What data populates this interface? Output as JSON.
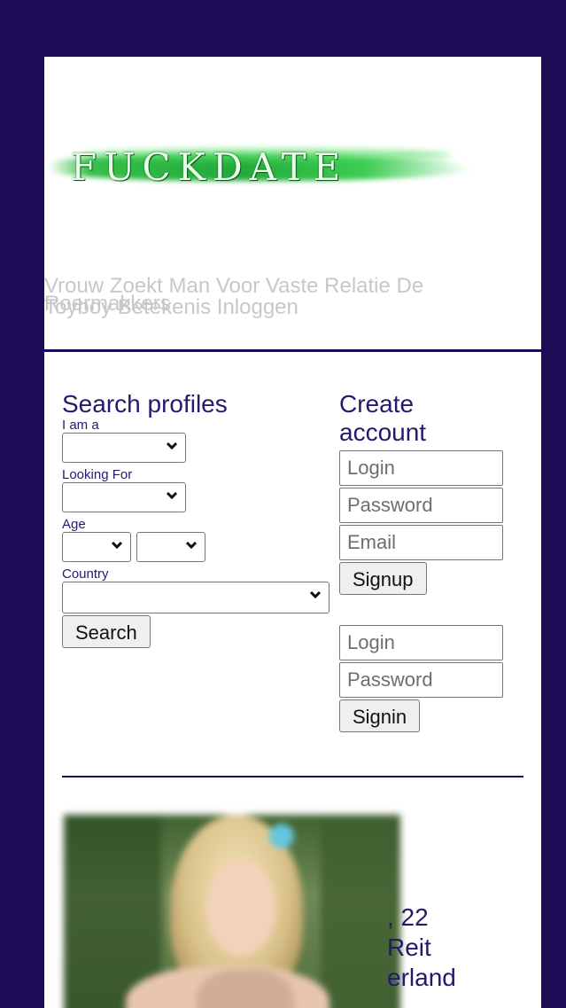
{
  "header": {
    "logo_text": "FUCKDATE",
    "tagline_line1": "Vrouw Zoekt Man Voor Vaste Relatie De",
    "tagline_line2": "Toyboy Betekenis Inloggen",
    "tagline_overlap": "Roermakkers"
  },
  "search": {
    "title": "Search profiles",
    "i_am_label": "I am a",
    "i_am_value": "",
    "looking_for_label": "Looking For",
    "looking_for_value": "",
    "age_label": "Age",
    "age_from_value": "",
    "age_to_value": "",
    "country_label": "Country",
    "country_value": "",
    "search_button": "Search"
  },
  "create_account": {
    "title_line1": "Create",
    "title_line2": "account",
    "login_placeholder": "Login",
    "password_placeholder": "Password",
    "email_placeholder": "Email",
    "signup_button": "Signup"
  },
  "signin": {
    "login_placeholder": "Login",
    "password_placeholder": "Password",
    "signin_button": "Signin"
  },
  "profile": {
    "line1": ", 22",
    "line2": "Reit",
    "line3": "erland"
  },
  "colors": {
    "background": "#1c0b55",
    "text_dark_blue": "#231a70",
    "logo_green": "#22a93a"
  }
}
